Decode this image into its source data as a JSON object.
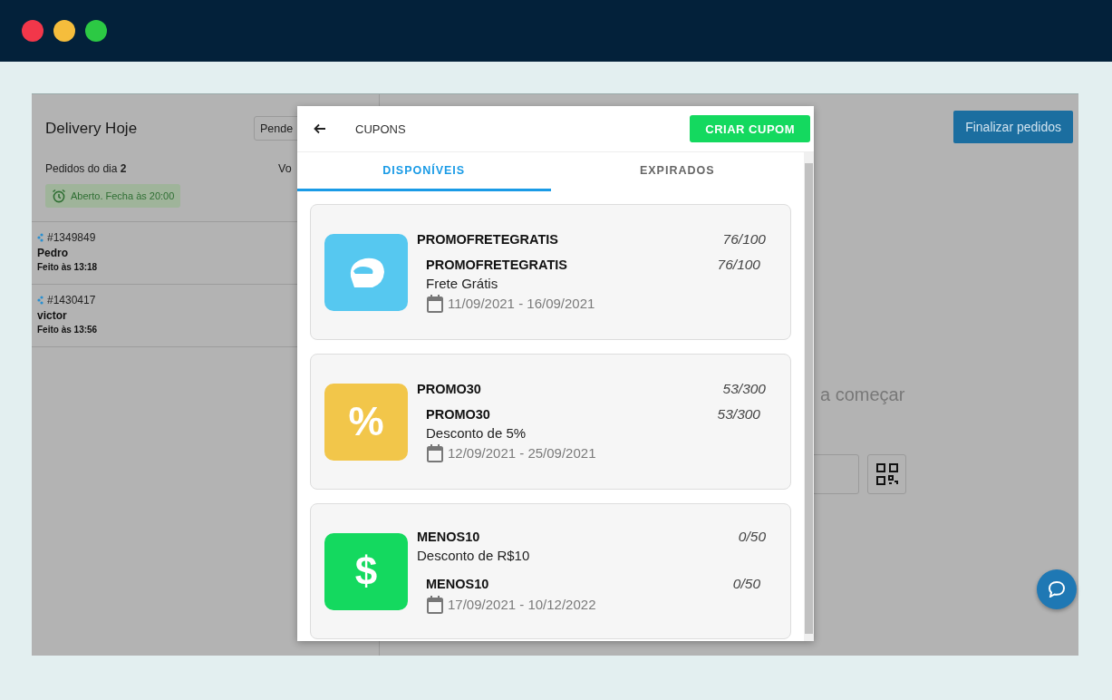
{
  "sidebar": {
    "title": "Delivery Hoje",
    "filter": {
      "value": "Pende"
    },
    "orders_label": "Pedidos do dia **2**",
    "column_label": "Vo",
    "status_badge": "Aberto. Fecha às 20:00",
    "orders": [
      {
        "id": "#1349849",
        "customer": "Pedro",
        "time": "Feito às 13:18"
      },
      {
        "id": "#1430417",
        "customer": "victor",
        "time": "Feito às 13:56"
      }
    ]
  },
  "main": {
    "action_button": "Finalizar pedidos",
    "hint": "a começar"
  },
  "modal": {
    "title": "CUPONS",
    "create_button": "CRIAR CUPOM",
    "tabs": [
      {
        "label": "DISPONÍVEIS",
        "selected": true
      },
      {
        "label": "EXPIRADOS",
        "selected": false
      }
    ],
    "coupons": [
      {
        "kind": "helmet",
        "color": "#56c8f0",
        "title": "PROMOFRETEGRATIS",
        "usage": "76/100",
        "detail": {
          "code": "PROMOFRETEGRATIS",
          "usage": "76/100",
          "description": "Frete Grátis"
        },
        "period": "11/09/2021 - 16/09/2021"
      },
      {
        "kind": "glyph",
        "glyph": "%",
        "color": "#f2c64a",
        "title": "PROMO30",
        "usage": "53/300",
        "detail": {
          "code": "PROMO30",
          "usage": "53/300",
          "description": "Desconto de 5%"
        },
        "period": "12/09/2021 - 25/09/2021"
      },
      {
        "kind": "glyph",
        "glyph": "$",
        "color": "#14d95f",
        "title": "MENOS10",
        "usage": "0/50",
        "description": "Desconto de R$10",
        "detail": {
          "code": "MENOS10",
          "usage": "0/50"
        },
        "period": "17/09/2021 - 10/12/2022"
      }
    ]
  }
}
